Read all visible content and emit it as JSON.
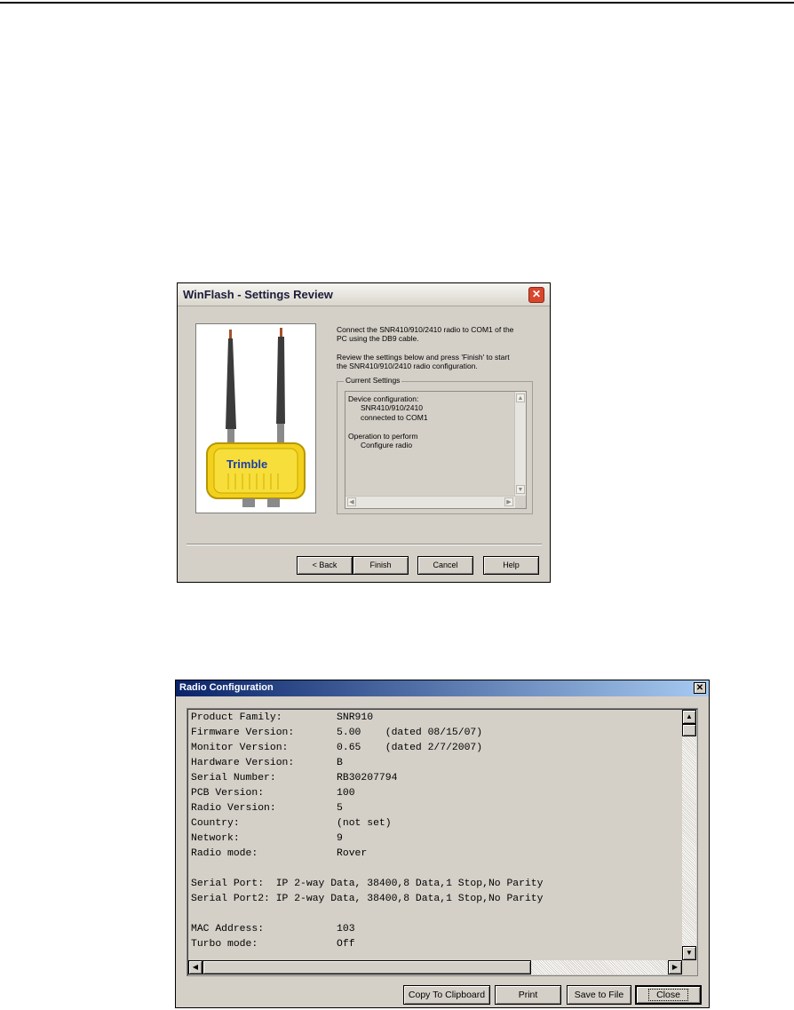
{
  "winflash": {
    "title": "WinFlash - Settings Review",
    "product_logo": "Trimble",
    "intro_line1": "Connect the SNR410/910/2410 radio to COM1 of the",
    "intro_line2": "PC using the DB9 cable.",
    "review_line1": "Review the settings below and press 'Finish' to start",
    "review_line2": "the SNR410/910/2410 radio configuration.",
    "group_label": "Current Settings",
    "settings": [
      "Device configuration:",
      "SNR410/910/2410",
      "connected to COM1",
      "Operation to perform",
      "Configure radio"
    ],
    "buttons": {
      "back": "< Back",
      "finish": "Finish",
      "cancel": "Cancel",
      "help": "Help"
    }
  },
  "radio_config": {
    "title": "Radio Configuration",
    "lines": [
      "Product Family:         SNR910",
      "Firmware Version:       5.00    (dated 08/15/07)",
      "Monitor Version:        0.65    (dated 2/7/2007)",
      "Hardware Version:       B",
      "Serial Number:          RB30207794",
      "PCB Version:            100",
      "Radio Version:          5",
      "Country:                (not set)",
      "Network:                9",
      "Radio mode:             Rover",
      "",
      "Serial Port:  IP 2-way Data, 38400,8 Data,1 Stop,No Parity",
      "Serial Port2: IP 2-way Data, 38400,8 Data,1 Stop,No Parity",
      "",
      "MAC Address:            103",
      "Turbo mode:             Off"
    ],
    "buttons": {
      "copy": "Copy To Clipboard",
      "print": "Print",
      "save": "Save to File",
      "close": "Close"
    }
  }
}
